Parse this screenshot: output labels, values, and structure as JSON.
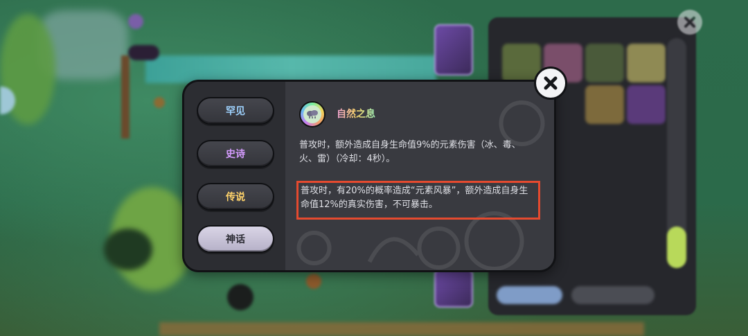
{
  "modal": {
    "skill_title": "自然之息",
    "desc_1": "普攻时，额外造成自身生命值9%的元素伤害（冰、毒、火、雷）（冷却：4秒）。",
    "desc_2": "普攻时，有20%的概率造成“元素风暴”，额外造成自身生命值12%的真实伤害，不可暴击。",
    "highlight_color": "#e54a2f"
  },
  "rarity_tabs": [
    {
      "label": "罕见",
      "color": "#9fd3ff",
      "selected": false
    },
    {
      "label": "史诗",
      "color": "#d59cff",
      "selected": false
    },
    {
      "label": "传说",
      "color": "#ffd36a",
      "selected": false
    },
    {
      "label": "神话",
      "color": "#ffffff",
      "selected": true
    }
  ],
  "icons": {
    "close": "close-icon",
    "skill": "nature-breath-icon"
  }
}
